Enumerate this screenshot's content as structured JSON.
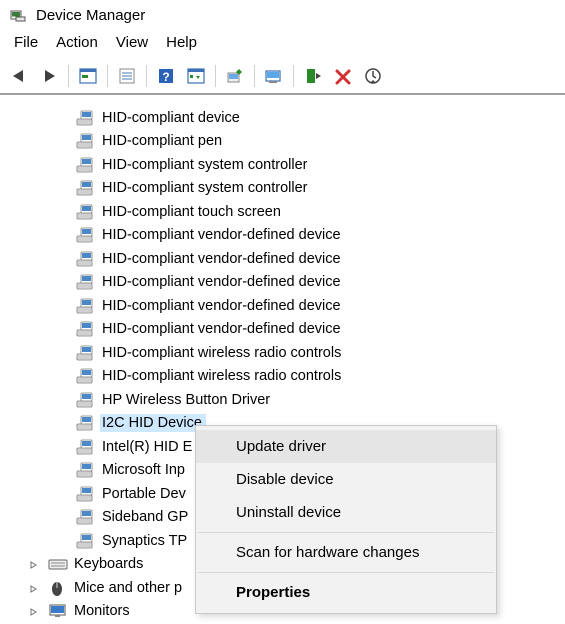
{
  "window": {
    "title": "Device Manager"
  },
  "menu": {
    "file": "File",
    "action": "Action",
    "view": "View",
    "help": "Help"
  },
  "toolbar_icons": [
    "back",
    "forward",
    "sep",
    "show-hidden",
    "sep",
    "properties-sheet",
    "sep",
    "help",
    "action-list",
    "sep",
    "update-driver",
    "sep",
    "scan",
    "sep",
    "enable",
    "uninstall",
    "refresh-2"
  ],
  "devices": [
    {
      "label": "HID-compliant device",
      "kind": "hid"
    },
    {
      "label": "HID-compliant pen",
      "kind": "hid"
    },
    {
      "label": "HID-compliant system controller",
      "kind": "hid"
    },
    {
      "label": "HID-compliant system controller",
      "kind": "hid"
    },
    {
      "label": "HID-compliant touch screen",
      "kind": "hid"
    },
    {
      "label": "HID-compliant vendor-defined device",
      "kind": "hid"
    },
    {
      "label": "HID-compliant vendor-defined device",
      "kind": "hid"
    },
    {
      "label": "HID-compliant vendor-defined device",
      "kind": "hid"
    },
    {
      "label": "HID-compliant vendor-defined device",
      "kind": "hid"
    },
    {
      "label": "HID-compliant vendor-defined device",
      "kind": "hid"
    },
    {
      "label": "HID-compliant wireless radio controls",
      "kind": "hid"
    },
    {
      "label": "HID-compliant wireless radio controls",
      "kind": "hid"
    },
    {
      "label": "HP Wireless Button Driver",
      "kind": "hid"
    },
    {
      "label": "I2C HID Device",
      "kind": "hid",
      "selected": true
    },
    {
      "label": "Intel(R) HID E",
      "kind": "hid"
    },
    {
      "label": "Microsoft Inp",
      "kind": "hid"
    },
    {
      "label": "Portable Dev",
      "kind": "hid"
    },
    {
      "label": "Sideband GP",
      "kind": "hid"
    },
    {
      "label": "Synaptics TP",
      "kind": "hid"
    }
  ],
  "categories": [
    {
      "label": "Keyboards",
      "icon": "keyboards"
    },
    {
      "label": "Mice and other p",
      "icon": "mice"
    },
    {
      "label": "Monitors",
      "icon": "monitors"
    }
  ],
  "context_menu": {
    "update": "Update driver",
    "disable": "Disable device",
    "uninstall": "Uninstall device",
    "scan": "Scan for hardware changes",
    "properties": "Properties"
  }
}
